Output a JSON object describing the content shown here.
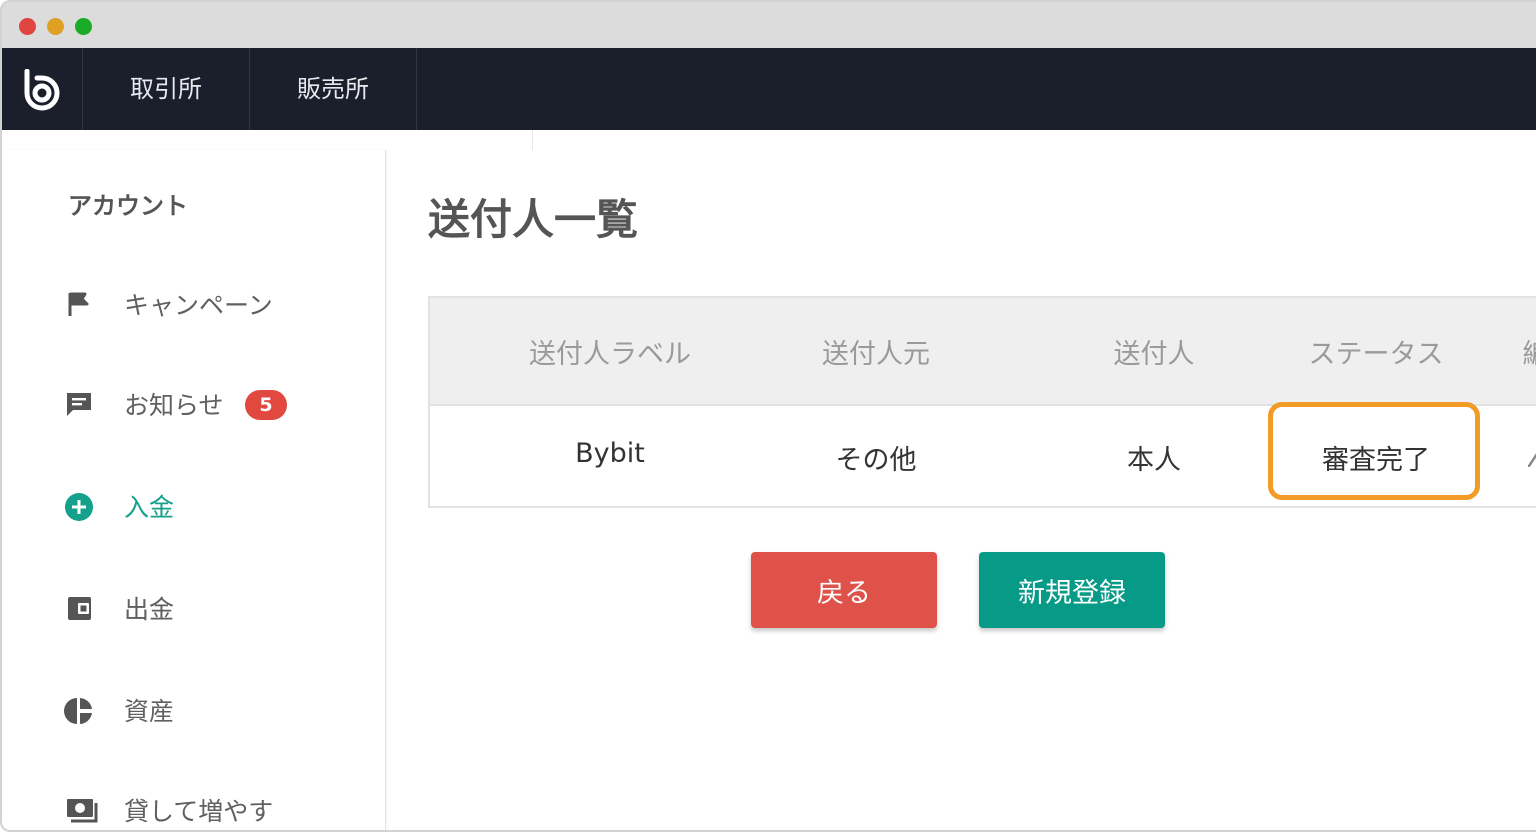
{
  "window": {
    "controls": {
      "close_color": "#e0443e",
      "minimize_color": "#dea123",
      "zoom_color": "#1aab29"
    }
  },
  "navbar": {
    "logo_icon": "bitbank-logo-icon",
    "items": [
      {
        "label": "取引所"
      },
      {
        "label": "販売所"
      }
    ]
  },
  "sidebar": {
    "heading": "アカウント",
    "items": [
      {
        "label": "キャンペーン",
        "icon": "flag-icon"
      },
      {
        "label": "お知らせ",
        "icon": "message-icon",
        "badge": "5"
      },
      {
        "label": "入金",
        "icon": "plus-circle-icon",
        "active": true
      },
      {
        "label": "出金",
        "icon": "wallet-icon"
      },
      {
        "label": "資産",
        "icon": "pie-chart-icon"
      },
      {
        "label": "貸して増やす",
        "icon": "cash-icon"
      }
    ]
  },
  "main": {
    "title": "送付人一覧",
    "table": {
      "headers": [
        "送付人ラベル",
        "送付人元",
        "送付人",
        "ステータス",
        "編"
      ],
      "rows": [
        {
          "label": "Bybit",
          "source": "その他",
          "sender": "本人",
          "status": "審査完了"
        }
      ],
      "highlight_color": "#f29b26"
    },
    "buttons": {
      "back_label": "戻る",
      "register_label": "新規登録"
    }
  },
  "colors": {
    "accent": "#14a08a",
    "danger": "#de524a",
    "primary": "#079a86",
    "navbar": "#1b1f2c"
  }
}
